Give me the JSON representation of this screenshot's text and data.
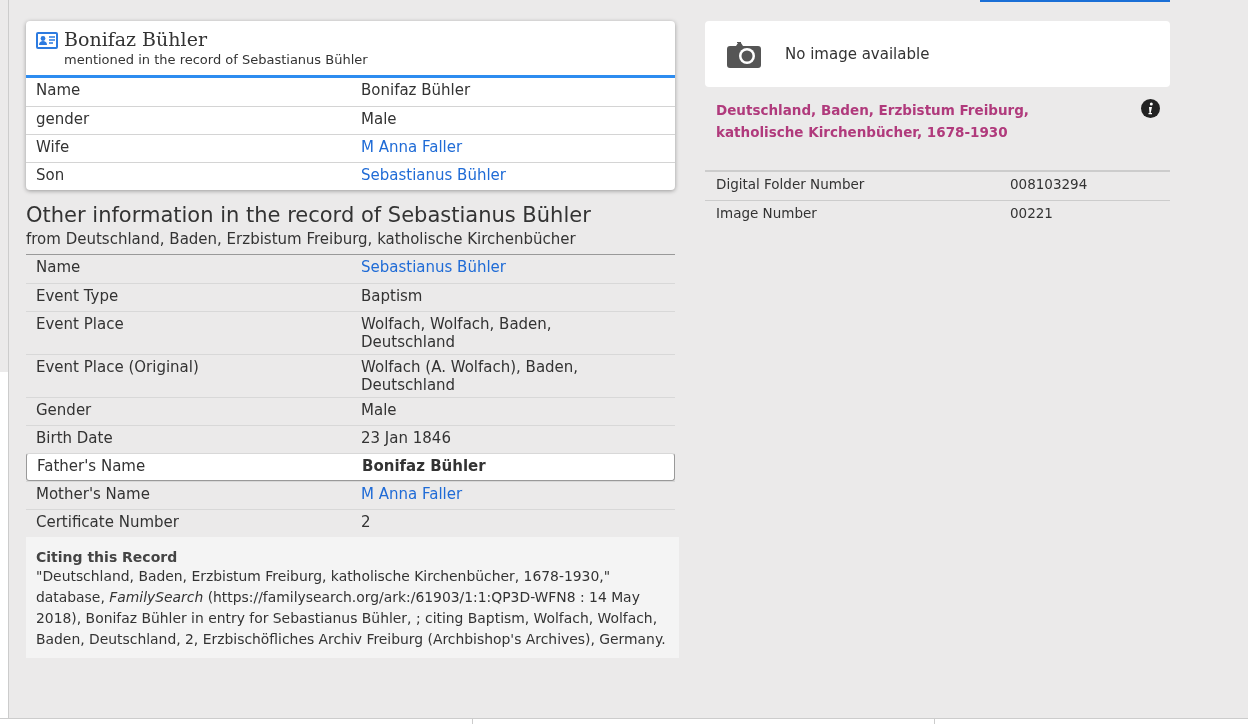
{
  "person_card": {
    "name": "Bonifaz Bühler",
    "subtitle": "mentioned in the record of Sebastianus Bühler",
    "fields": [
      {
        "label": "Name",
        "value": "Bonifaz Bühler",
        "link": false
      },
      {
        "label": "gender",
        "value": "Male",
        "link": false
      },
      {
        "label": "Wife",
        "value": "M Anna Faller",
        "link": true
      },
      {
        "label": "Son",
        "value": "Sebastianus Bühler",
        "link": true
      }
    ]
  },
  "record": {
    "title": "Other information in the record of Sebastianus Bühler",
    "subtitle": "from Deutschland, Baden, Erzbistum Freiburg, katholische Kirchenbücher",
    "fields": [
      {
        "label": "Name",
        "value": "Sebastianus Bühler",
        "link": true,
        "highlighted": false
      },
      {
        "label": "Event Type",
        "value": "Baptism",
        "link": false,
        "highlighted": false
      },
      {
        "label": "Event Place",
        "value": "Wolfach, Wolfach, Baden, Deutschland",
        "link": false,
        "highlighted": false
      },
      {
        "label": "Event Place (Original)",
        "value": "Wolfach (A. Wolfach), Baden, Deutschland",
        "link": false,
        "highlighted": false
      },
      {
        "label": "Gender",
        "value": "Male",
        "link": false,
        "highlighted": false
      },
      {
        "label": "Birth Date",
        "value": "23 Jan 1846",
        "link": false,
        "highlighted": false
      },
      {
        "label": "Father's Name",
        "value": "Bonifaz Bühler",
        "link": false,
        "highlighted": true
      },
      {
        "label": "Mother's Name",
        "value": "M Anna Faller",
        "link": true,
        "highlighted": false
      },
      {
        "label": "Certificate Number",
        "value": "2",
        "link": false,
        "highlighted": false
      }
    ]
  },
  "citation": {
    "heading": "Citing this Record",
    "text": "\"Deutschland, Baden, Erzbistum Freiburg, katholische Kirchenbücher, 1678-1930,\" database, *FamilySearch* (https://familysearch.org/ark:/61903/1:1:QP3D-WFN8 : 14 May 2018), Bonifaz Bühler in entry for Sebastianus Bühler, ; citing Baptism, Wolfach, Wolfach, Baden, Deutschland, 2, Erzbischöfliches Archiv Freiburg (Archbishop's Archives), Germany."
  },
  "image_panel": {
    "message": "No image available"
  },
  "collection": {
    "title": "Deutschland, Baden, Erzbistum Freiburg, katholische Kirchenbücher, 1678-1930",
    "fields": [
      {
        "label": "Digital Folder Number",
        "value": "008103294"
      },
      {
        "label": "Image Number",
        "value": "00221"
      }
    ]
  }
}
